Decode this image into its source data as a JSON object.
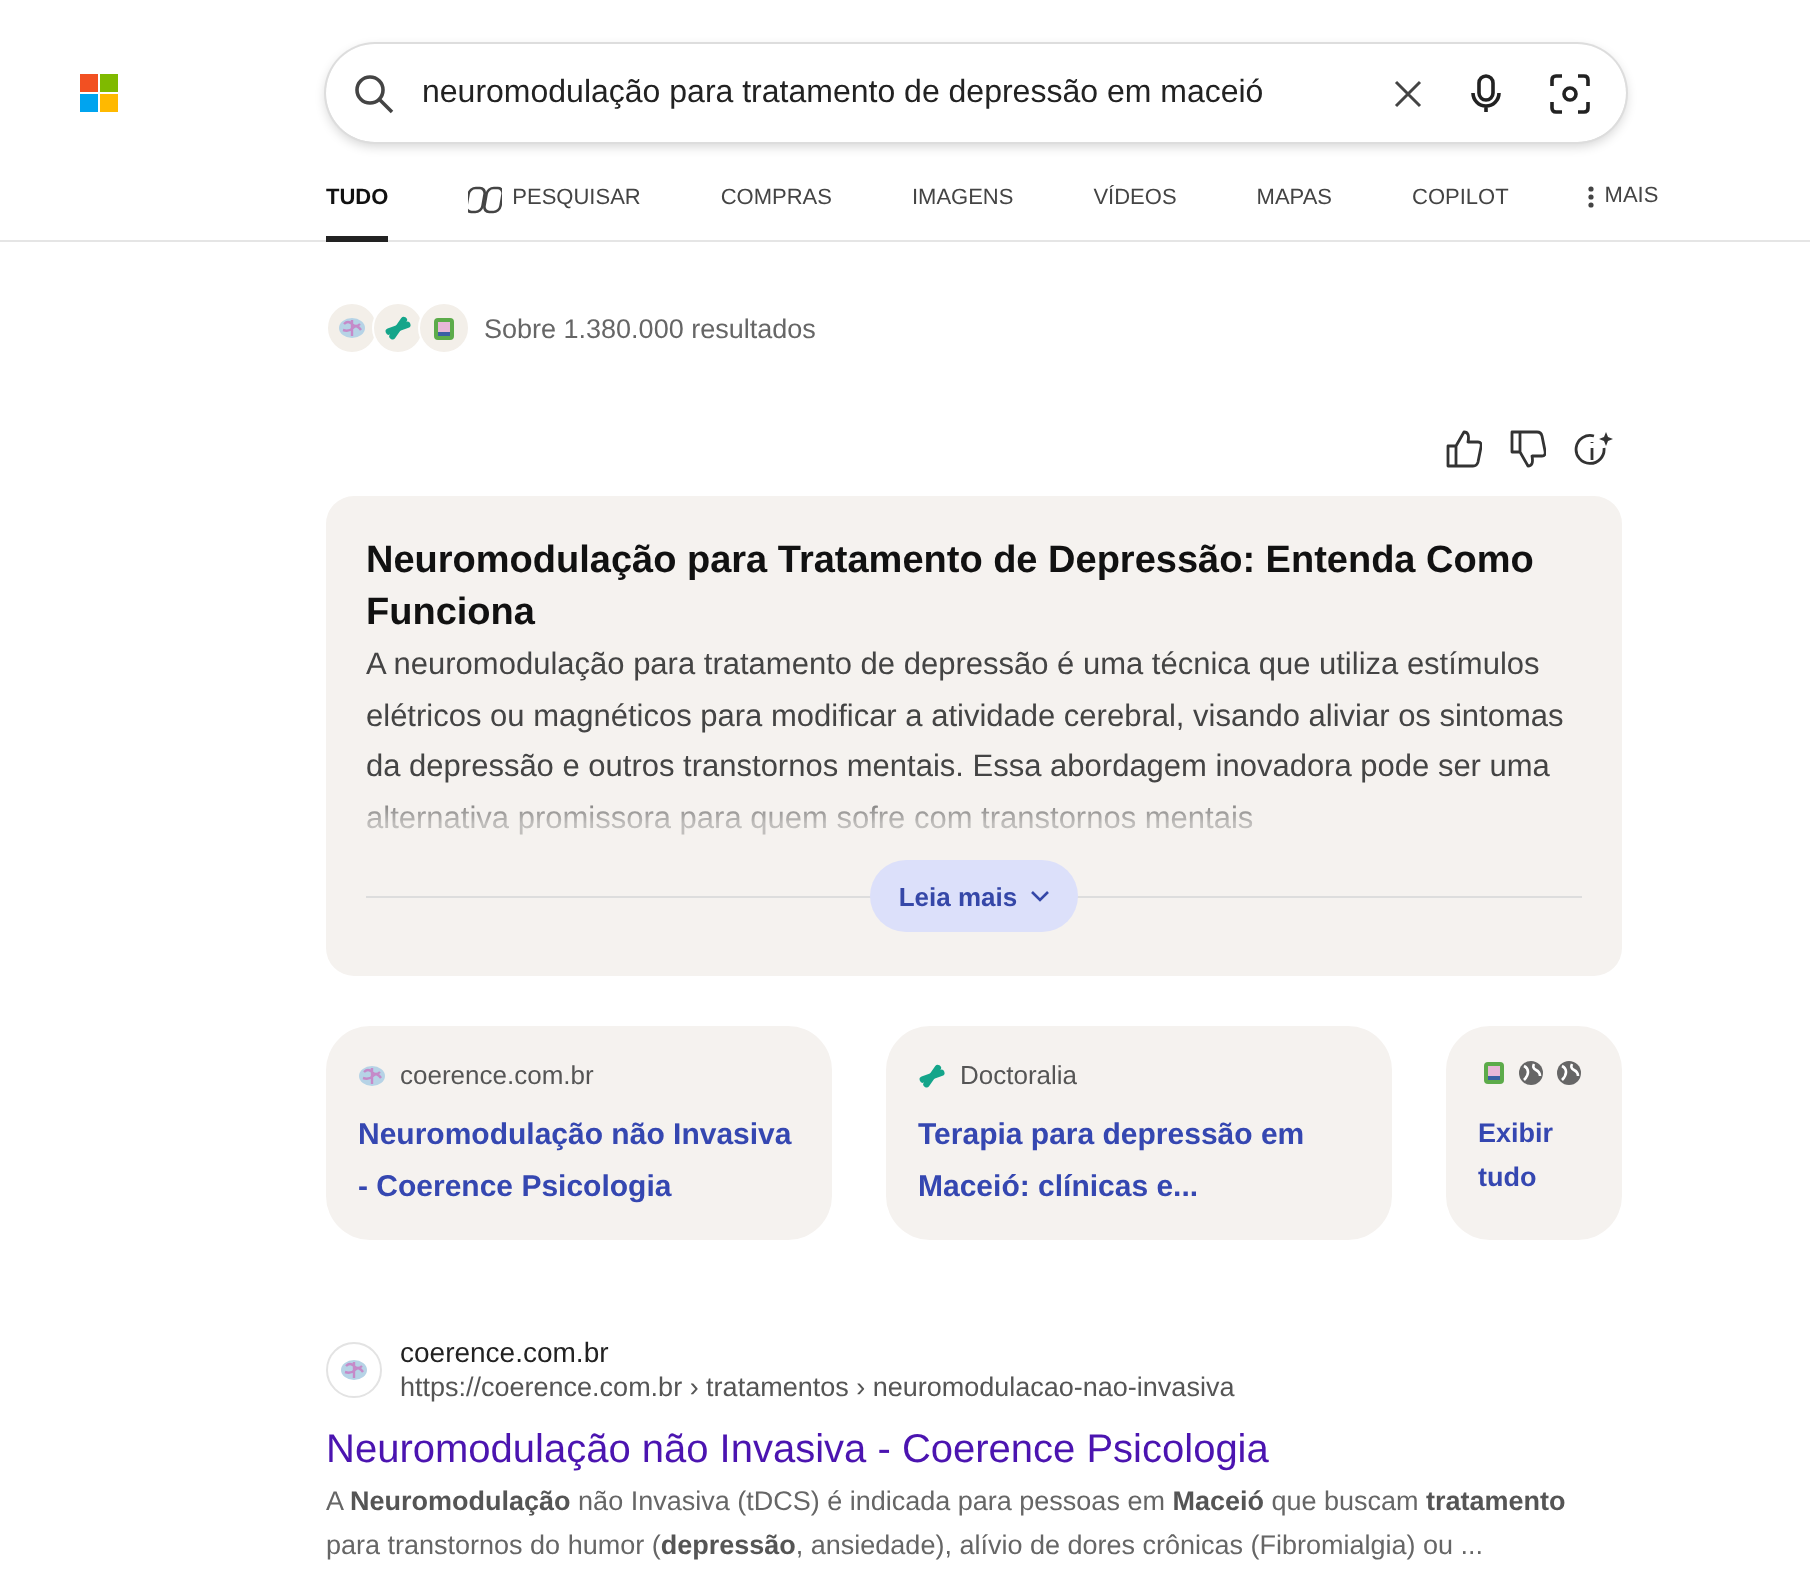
{
  "search": {
    "value": "neuromodulação para tratamento de depressão em maceió"
  },
  "tabs": [
    {
      "label": "TUDO",
      "selected": true,
      "kind": "plain"
    },
    {
      "label": "PESQUISAR",
      "selected": false,
      "kind": "copilot"
    },
    {
      "label": "COMPRAS",
      "selected": false,
      "kind": "plain"
    },
    {
      "label": "IMAGENS",
      "selected": false,
      "kind": "plain"
    },
    {
      "label": "VÍDEOS",
      "selected": false,
      "kind": "plain"
    },
    {
      "label": "MAPAS",
      "selected": false,
      "kind": "plain"
    },
    {
      "label": "COPILOT",
      "selected": false,
      "kind": "plain"
    },
    {
      "label": "MAIS",
      "selected": false,
      "kind": "more"
    }
  ],
  "result_count": "Sobre 1.380.000 resultados",
  "summary": {
    "title": "Neuromodulação para Tratamento de Depressão: Entenda Como Funciona",
    "text": "A neuromodulação para tratamento de depressão é uma técnica que utiliza estímulos elétricos ou magnéticos para modificar a atividade cerebral, visando aliviar os sintomas da depressão e outros transtornos mentais. Essa abordagem inovadora pode ser uma alternativa promissora para quem sofre com transtornos mentais",
    "button": "Leia mais"
  },
  "source_cards": [
    {
      "kind": "source",
      "site": "coerence.com.br",
      "title": "Neuromodulação não Invasiva - Coerence Psicologia"
    },
    {
      "kind": "source",
      "site": "Doctoralia",
      "title": "Terapia para depressão em Maceió: clínicas e..."
    },
    {
      "kind": "more",
      "label": "Exibir tudo"
    }
  ],
  "result": {
    "site": "coerence.com.br",
    "url": "https://coerence.com.br › tratamentos › neuromodulacao-nao-invasiva",
    "title": "Neuromodulação não Invasiva - Coerence Psicologia",
    "snippet": "A **Neuromodulação** não Invasiva (tDCS) é indicada para pessoas em **Maceió** que buscam **tratamento** para transtornos do humor (**depressão**, ansiedade), alívio de dores crônicas (Fibromialgia) ou ..."
  }
}
